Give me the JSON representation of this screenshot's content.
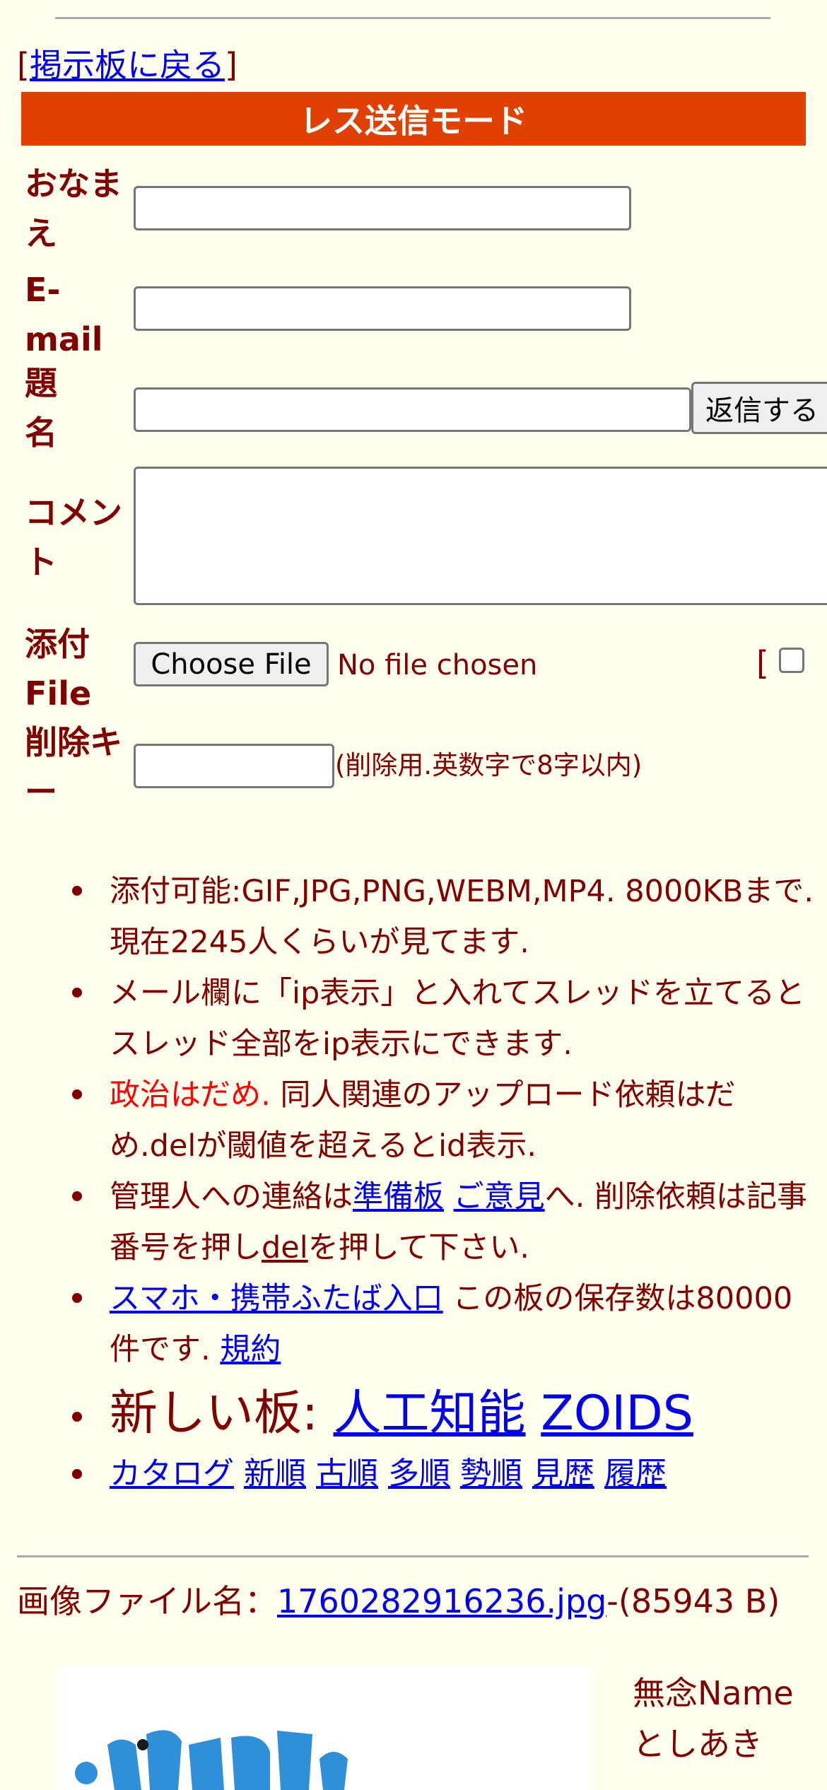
{
  "nav": {
    "open_bracket": "[",
    "back_link": "掲示板に戻る",
    "close_bracket": "]"
  },
  "form": {
    "title": "レス送信モード",
    "name_label": "おなまえ",
    "email_label": "E-mail",
    "subject_label": "題名",
    "submit_label": "返信する",
    "comment_label": "コメント",
    "file_label": "添付File",
    "choose_file_label": "Choose File",
    "no_file_text": "No file chosen",
    "image_option_bracket": "[",
    "delete_key_label": "削除キー",
    "delete_key_hint": "(削除用.英数字で8字以内)"
  },
  "rules": {
    "r1": "添付可能:GIF,JPG,PNG,WEBM,MP4. 8000KBまで. 現在2245人くらいが見てます.",
    "r2": "メール欄に「ip表示」と入れてスレッドを立てるとスレッド全部をip表示にできます.",
    "r3_red": "政治はだめ.",
    "r3_rest": " 同人関連のアップロード依頼はだめ.delが閾値を超えるとid表示.",
    "r4_a": "管理人への連絡は",
    "r4_link1": "準備板",
    "r4_link2": "ご意見",
    "r4_b": "へ. 削除依頼は記事番号を押し",
    "r4_link3": "del",
    "r4_c": "を押して下さい.",
    "r5_link": "スマホ・携帯ふたば入口",
    "r5_text": " この板の保存数は80000件です. ",
    "r5_link2": "規約",
    "new_boards_label": "新しい板:",
    "new_board_1": "人工知能",
    "new_board_2": "ZOIDS",
    "sort_links": [
      "カタログ",
      "新順",
      "古順",
      "多順",
      "勢順",
      "見歴",
      "履歴"
    ]
  },
  "post": {
    "file_label": "画像ファイル名：",
    "file_name": "1760282916236.jpg",
    "file_size": "-(85943 B)",
    "name": "無念Name",
    "author": "としあき"
  },
  "colors": {
    "background": "#ffffee",
    "text": "#800000",
    "header_bar": "#e04000",
    "link": "#0000ee",
    "warning": "#ff0000"
  }
}
